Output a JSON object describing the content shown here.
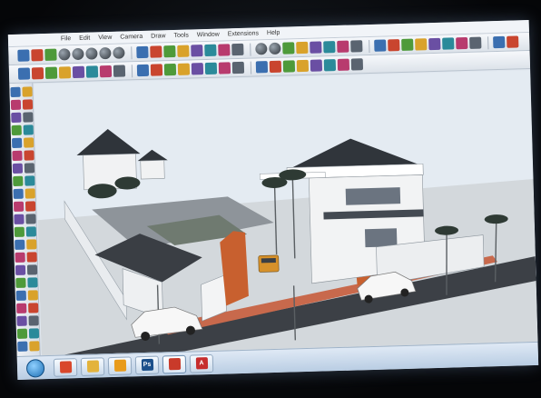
{
  "app": {
    "menus": [
      "File",
      "Edit",
      "View",
      "Camera",
      "Draw",
      "Tools",
      "Window",
      "Extensions",
      "Help"
    ]
  },
  "toolbar_top": {
    "icons": [
      "select-icon",
      "erase-icon",
      "paint-icon",
      "sphere-icon",
      "sphere-icon",
      "sphere-icon",
      "sphere-icon",
      "sphere-icon",
      "pencil-icon",
      "arc-icon",
      "star-icon",
      "shape-icon",
      "rotate-icon",
      "move-icon",
      "scale-icon",
      "offset-icon",
      "sphere-icon",
      "sphere-icon",
      "tape-icon",
      "protractor-icon",
      "axes-icon",
      "text-icon",
      "dimension-icon",
      "section-icon",
      "orbit-icon",
      "pan-icon",
      "zoom-icon",
      "zoom-extents-icon",
      "camera-icon",
      "home-icon",
      "house-icon",
      "house-icon",
      "house-icon",
      "warehouse-icon"
    ]
  },
  "toolbar_second": {
    "icons": [
      "arrow-select-icon",
      "pencil-icon",
      "line-icon",
      "rectangle-icon",
      "circle-icon",
      "polygon-icon",
      "push-pull-icon",
      "follow-me-icon",
      "move-icon",
      "rotate-icon",
      "scale-icon",
      "offset-icon",
      "tape-icon",
      "text-icon",
      "orbit-icon",
      "pan-icon",
      "zoom-icon",
      "magnify-icon",
      "close-icon",
      "section-icon",
      "components-icon",
      "materials-icon",
      "styles-icon",
      "layers-icon"
    ]
  },
  "taskbar": {
    "apps": [
      {
        "name": "chrome-icon",
        "label": "",
        "color": "#d9472b"
      },
      {
        "name": "folder-icon",
        "label": "",
        "color": "#e3b33c"
      },
      {
        "name": "media-player-icon",
        "label": "",
        "color": "#e89b1b"
      },
      {
        "name": "photoshop-icon",
        "label": "Ps",
        "color": "#1b4f8a"
      },
      {
        "name": "sketchup-icon",
        "label": "",
        "color": "#c93a2a"
      },
      {
        "name": "autocad-icon",
        "label": "A",
        "color": "#c62d2d"
      }
    ]
  },
  "colors": {
    "sky": "#e6edf3",
    "ground": "#cdd3d8",
    "road": "#3b3f45",
    "roof": "#3a3f46",
    "wall": "#f3f4f6",
    "accent_brick": "#c7603a"
  }
}
